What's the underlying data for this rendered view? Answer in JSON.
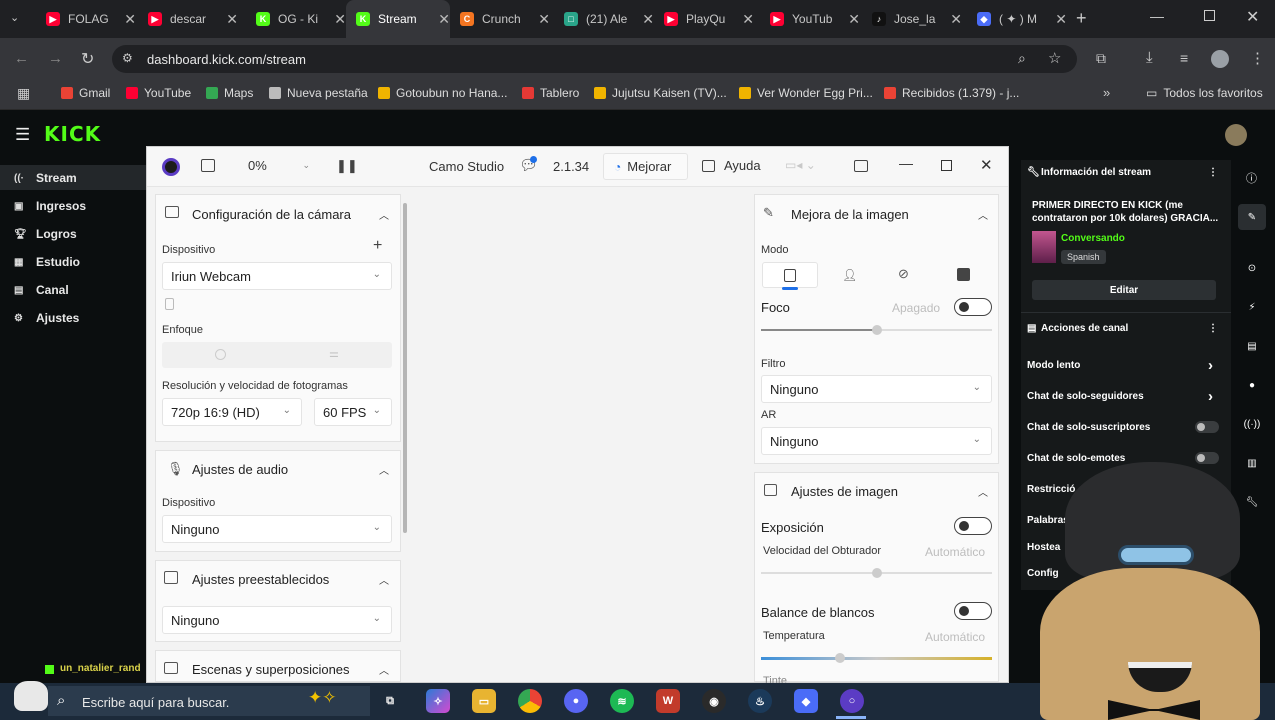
{
  "browser": {
    "tabs": [
      {
        "label": "FOLAG",
        "color": "#ff0033",
        "glyph": "▶"
      },
      {
        "label": "descar",
        "color": "#ff0033",
        "glyph": "▶"
      },
      {
        "label": "OG - Ki",
        "color": "#53fc18",
        "glyph": "K"
      },
      {
        "label": "Stream",
        "color": "#53fc18",
        "glyph": "K"
      },
      {
        "label": "Crunch",
        "color": "#f47521",
        "glyph": "C"
      },
      {
        "label": "(21) Ale",
        "color": "#2aa58a",
        "glyph": "□"
      },
      {
        "label": "PlayQu",
        "color": "#ff0033",
        "glyph": "▶"
      },
      {
        "label": "YouTub",
        "color": "#ff0033",
        "glyph": "▶"
      },
      {
        "label": "Jose_la",
        "color": "#111",
        "glyph": "♪"
      },
      {
        "label": "( ✦ ) M",
        "color": "#4a6cf7",
        "glyph": "◆"
      }
    ],
    "url": "dashboard.kick.com/stream",
    "bookmarks": [
      {
        "label": "Gmail",
        "color": "#ea4335"
      },
      {
        "label": "YouTube",
        "color": "#ff0033"
      },
      {
        "label": "Maps",
        "color": "#34a853"
      },
      {
        "label": "Nueva pestaña",
        "color": "#bbbbbb"
      },
      {
        "label": "Gotoubun no Hana...",
        "color": "#f0b400"
      },
      {
        "label": "Tablero",
        "color": "#e53935"
      },
      {
        "label": "Jujutsu Kaisen (TV)...",
        "color": "#f0b400"
      },
      {
        "label": "Ver Wonder Egg Pri...",
        "color": "#f0b400"
      },
      {
        "label": "Recibidos (1.379) - j...",
        "color": "#ea4335"
      }
    ],
    "favorites_label": "Todos los favoritos"
  },
  "kick": {
    "logo": "KICK",
    "logo_color": "#53fc18",
    "nav": [
      {
        "label": "Stream",
        "icon": "broadcast-icon"
      },
      {
        "label": "Ingresos",
        "icon": "wallet-icon"
      },
      {
        "label": "Logros",
        "icon": "trophy-icon"
      },
      {
        "label": "Estudio",
        "icon": "studio-icon"
      },
      {
        "label": "Canal",
        "icon": "channel-icon"
      },
      {
        "label": "Ajustes",
        "icon": "gear-icon"
      }
    ],
    "stream_info": {
      "header": "Información del stream",
      "title": "PRIMER DIRECTO EN KICK (me contrataron por 10k dolares) GRACIA...",
      "category": "Conversando",
      "language": "Spanish",
      "edit": "Editar"
    },
    "channel_actions": {
      "header": "Acciones de canal",
      "items": [
        {
          "label": "Modo lento",
          "control": "chevron"
        },
        {
          "label": "Chat de solo-seguidores",
          "control": "chevron"
        },
        {
          "label": "Chat de solo-suscriptores",
          "control": "toggle"
        },
        {
          "label": "Chat de solo-emotes",
          "control": "toggle"
        },
        {
          "label": "Restricció",
          "control": "none"
        },
        {
          "label": "Palabras",
          "control": "none"
        },
        {
          "label": "Hostea",
          "control": "none"
        },
        {
          "label": "Config",
          "control": "none"
        }
      ]
    },
    "chat_user": "un_natalier_rand"
  },
  "camo": {
    "zoom": "0%",
    "app_name": "Camo Studio",
    "version": "2.1.34",
    "improve": "Mejorar",
    "help": "Ayuda",
    "camera": {
      "title": "Configuración de la cámara",
      "device_label": "Dispositivo",
      "device": "Iriun Webcam",
      "focus_label": "Enfoque",
      "res_label": "Resolución y velocidad de fotogramas",
      "resolution": "720p 16:9 (HD)",
      "fps": "60 FPS"
    },
    "audio": {
      "title": "Ajustes de audio",
      "device_label": "Dispositivo",
      "device": "Ninguno"
    },
    "presets": {
      "title": "Ajustes preestablecidos",
      "value": "Ninguno"
    },
    "scenes": {
      "title": "Escenas y superposiciones"
    },
    "enhance": {
      "title": "Mejora de la imagen",
      "mode_label": "Modo",
      "focus_label": "Foco",
      "focus_state": "Apagado",
      "filter_label": "Filtro",
      "filter": "Ninguno",
      "ar_label": "AR",
      "ar": "Ninguno"
    },
    "image": {
      "title": "Ajustes de imagen",
      "exposure": "Exposición",
      "shutter": "Velocidad del Obturador",
      "auto": "Automático",
      "wb": "Balance de blancos",
      "temp": "Temperatura",
      "tint": "Tinte"
    }
  },
  "taskbar": {
    "search": "Escribe aquí para buscar."
  }
}
